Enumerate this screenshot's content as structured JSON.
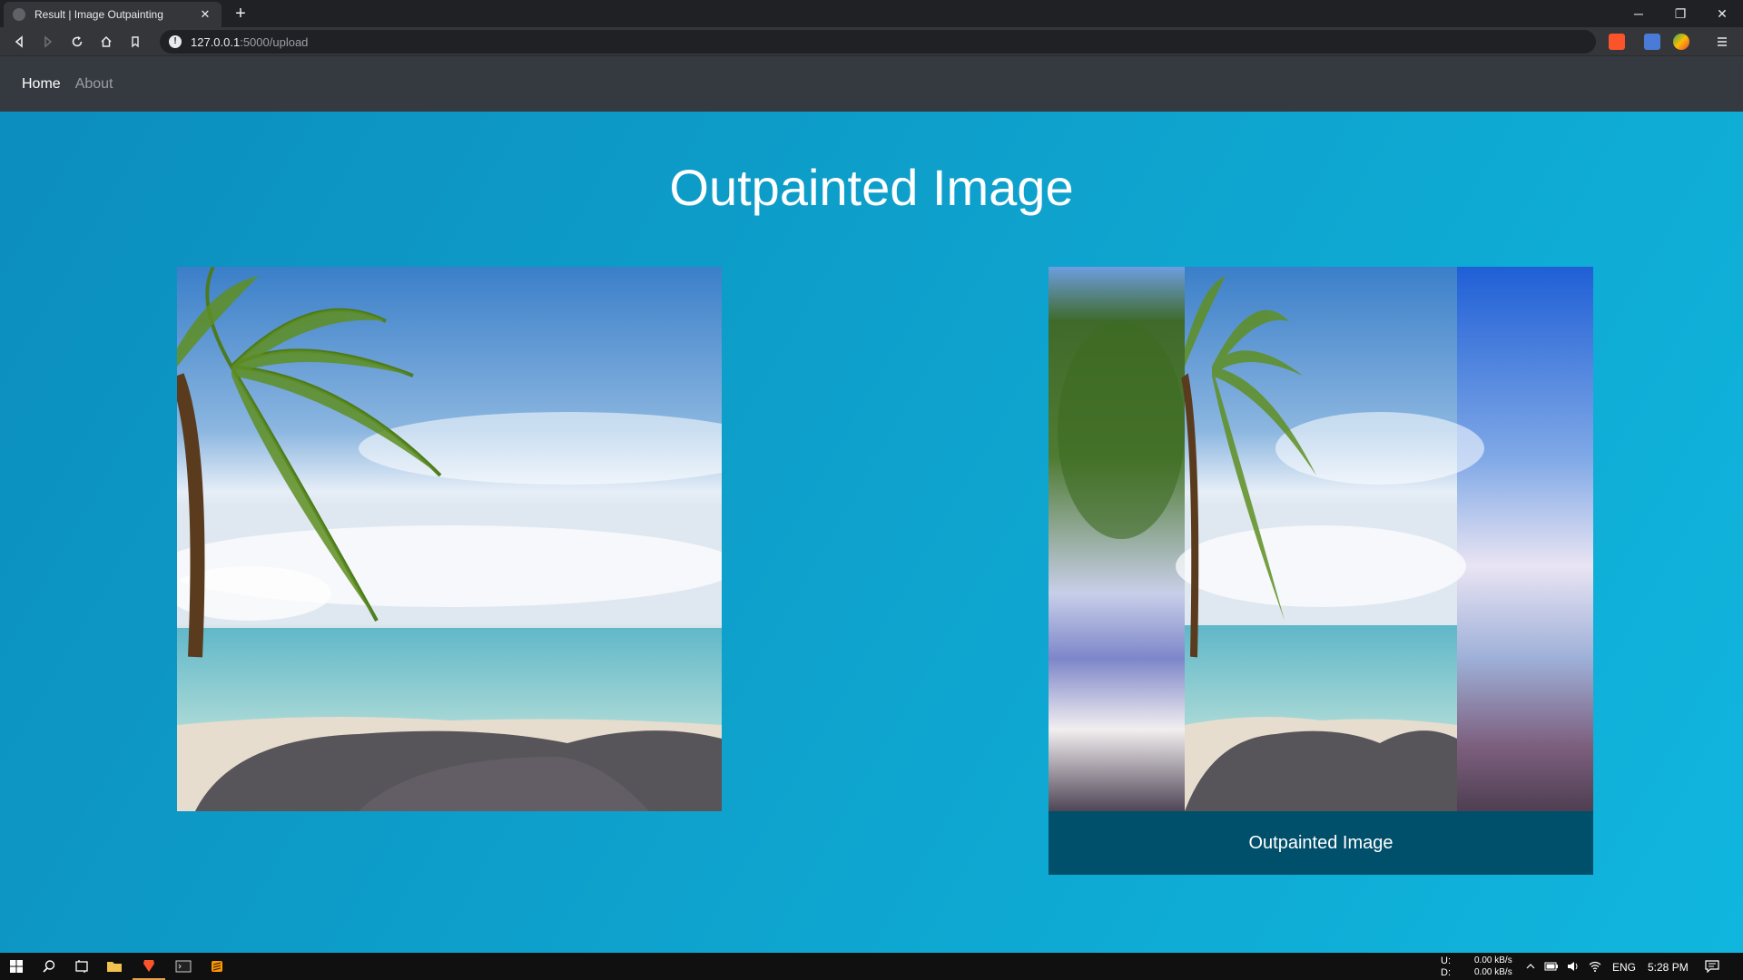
{
  "browser": {
    "tab_title": "Result | Image Outpainting",
    "tab_close": "✕",
    "new_tab": "+",
    "url_host": "127.0.0.1",
    "url_path": ":5000/upload",
    "window_controls": {
      "minimize": "─",
      "restore": "❐",
      "close": "✕"
    },
    "extension_icons": [
      "brave-shields-icon",
      "translate-icon",
      "extension-icon",
      "menu-icon"
    ]
  },
  "navbar": {
    "links": [
      {
        "label": "Home",
        "active": true
      },
      {
        "label": "About",
        "active": false
      }
    ]
  },
  "main": {
    "title": "Outpainted Image",
    "caption": "Outpainted Image"
  },
  "taskbar": {
    "network_up_label": "U:",
    "network_down_label": "D:",
    "network_up": "0.00 kB/s",
    "network_down": "0.00 kB/s",
    "language": "ENG",
    "time": "5:28 PM"
  },
  "colors": {
    "page_background": "#0ea6d0",
    "navbar": "#343a40",
    "caption_background": "#004f6b"
  }
}
